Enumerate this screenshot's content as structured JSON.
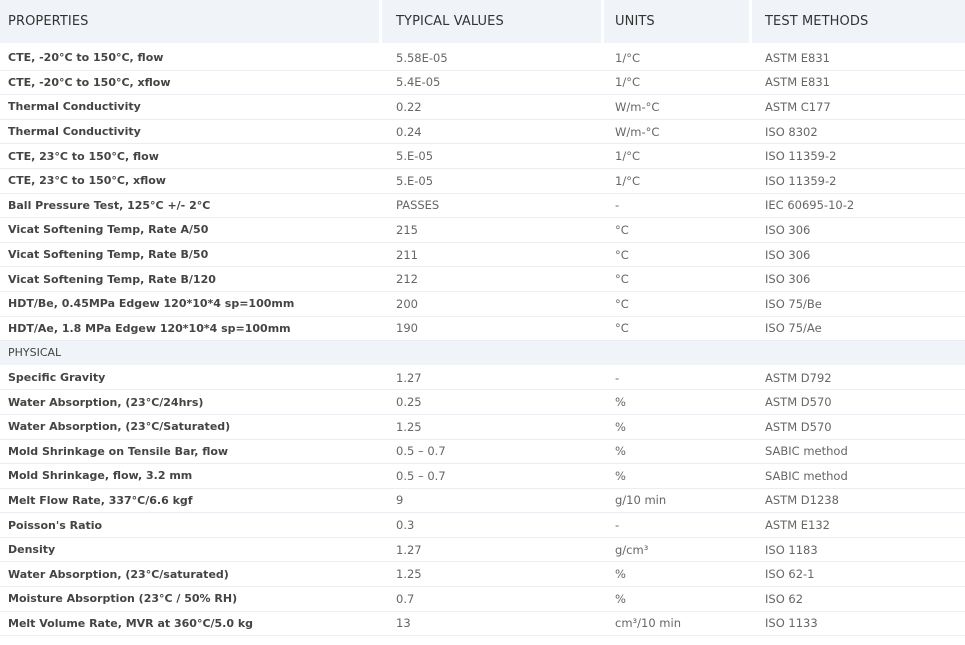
{
  "headers": {
    "properties": "PROPERTIES",
    "typical_values": "TYPICAL VALUES",
    "units": "UNITS",
    "test_methods": "TEST METHODS"
  },
  "thermal_rows": [
    {
      "property": "CTE, -20°C to 150°C, flow",
      "value": "5.58E-05",
      "unit": "1/°C",
      "method": "ASTM E831"
    },
    {
      "property": "CTE, -20°C to 150°C, xflow",
      "value": "5.4E-05",
      "unit": "1/°C",
      "method": "ASTM E831"
    },
    {
      "property": "Thermal Conductivity",
      "value": "0.22",
      "unit": "W/m-°C",
      "method": "ASTM C177"
    },
    {
      "property": "Thermal Conductivity",
      "value": "0.24",
      "unit": "W/m-°C",
      "method": "ISO 8302"
    },
    {
      "property": "CTE, 23°C to 150°C, flow",
      "value": "5.E-05",
      "unit": "1/°C",
      "method": "ISO 11359-2"
    },
    {
      "property": "CTE, 23°C to 150°C, xflow",
      "value": "5.E-05",
      "unit": "1/°C",
      "method": "ISO 11359-2"
    },
    {
      "property": "Ball Pressure Test, 125°C +/- 2°C",
      "value": "PASSES",
      "unit": "-",
      "method": "IEC 60695-10-2"
    },
    {
      "property": "Vicat Softening Temp, Rate A/50",
      "value": "215",
      "unit": "°C",
      "method": "ISO 306"
    },
    {
      "property": "Vicat Softening Temp, Rate B/50",
      "value": "211",
      "unit": "°C",
      "method": "ISO 306"
    },
    {
      "property": "Vicat Softening Temp, Rate B/120",
      "value": "212",
      "unit": "°C",
      "method": "ISO 306"
    },
    {
      "property": "HDT/Be, 0.45MPa Edgew 120*10*4 sp=100mm",
      "value": "200",
      "unit": "°C",
      "method": "ISO 75/Be"
    },
    {
      "property": "HDT/Ae, 1.8 MPa Edgew 120*10*4 sp=100mm",
      "value": "190",
      "unit": "°C",
      "method": "ISO 75/Ae"
    }
  ],
  "section_physical": "PHYSICAL",
  "physical_rows": [
    {
      "property": "Specific Gravity",
      "value": "1.27",
      "unit": "-",
      "method": "ASTM D792"
    },
    {
      "property": "Water Absorption, (23°C/24hrs)",
      "value": "0.25",
      "unit": "%",
      "method": "ASTM D570"
    },
    {
      "property": "Water Absorption, (23°C/Saturated)",
      "value": "1.25",
      "unit": "%",
      "method": "ASTM D570"
    },
    {
      "property": "Mold Shrinkage on Tensile Bar, flow",
      "value": "0.5 – 0.7",
      "unit": "%",
      "method": "SABIC method"
    },
    {
      "property": "Mold Shrinkage, flow, 3.2 mm",
      "value": "0.5 – 0.7",
      "unit": "%",
      "method": "SABIC method"
    },
    {
      "property": "Melt Flow Rate, 337°C/6.6 kgf",
      "value": "9",
      "unit": "g/10 min",
      "method": "ASTM D1238"
    },
    {
      "property": "Poisson's Ratio",
      "value": "0.3",
      "unit": "-",
      "method": "ASTM E132"
    },
    {
      "property": "Density",
      "value": "1.27",
      "unit": "g/cm³",
      "method": "ISO 1183"
    },
    {
      "property": "Water Absorption, (23°C/saturated)",
      "value": "1.25",
      "unit": "%",
      "method": "ISO 62-1"
    },
    {
      "property": "Moisture Absorption (23°C / 50% RH)",
      "value": "0.7",
      "unit": "%",
      "method": "ISO 62"
    },
    {
      "property": "Melt Volume Rate, MVR at 360°C/5.0 kg",
      "value": "13",
      "unit": "cm³/10 min",
      "method": "ISO 1133"
    }
  ]
}
